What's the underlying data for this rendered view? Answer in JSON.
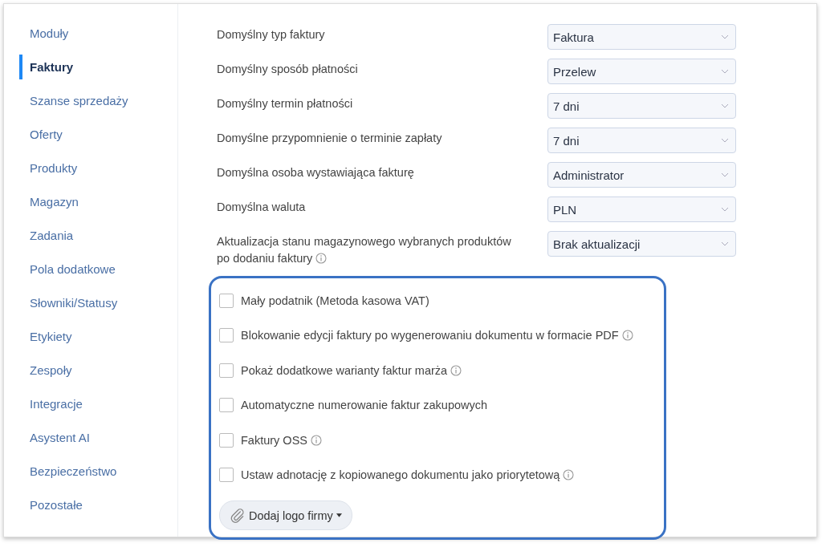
{
  "sidebar": {
    "items": [
      {
        "label": "Moduły",
        "selected": false
      },
      {
        "label": "Faktury",
        "selected": true
      },
      {
        "label": "Szanse sprzedaży",
        "selected": false
      },
      {
        "label": "Oferty",
        "selected": false
      },
      {
        "label": "Produkty",
        "selected": false
      },
      {
        "label": "Magazyn",
        "selected": false
      },
      {
        "label": "Zadania",
        "selected": false
      },
      {
        "label": "Pola dodatkowe",
        "selected": false
      },
      {
        "label": "Słowniki/Statusy",
        "selected": false
      },
      {
        "label": "Etykiety",
        "selected": false
      },
      {
        "label": "Zespoły",
        "selected": false
      },
      {
        "label": "Integracje",
        "selected": false
      },
      {
        "label": "Asystent AI",
        "selected": false
      },
      {
        "label": "Bezpieczeństwo",
        "selected": false
      },
      {
        "label": "Pozostałe",
        "selected": false
      }
    ]
  },
  "settings": [
    {
      "label": "Domyślny typ faktury",
      "value": "Faktura",
      "info": false
    },
    {
      "label": "Domyślny sposób płatności",
      "value": "Przelew",
      "info": false
    },
    {
      "label": "Domyślny termin płatności",
      "value": "7 dni",
      "info": false
    },
    {
      "label": "Domyślne przypomnienie o terminie zapłaty",
      "value": "7 dni",
      "info": false
    },
    {
      "label": "Domyślna osoba wystawiająca fakturę",
      "value": "Administrator",
      "info": false
    },
    {
      "label": "Domyślna waluta",
      "value": "PLN",
      "info": false
    },
    {
      "label": "Aktualizacja stanu magazynowego wybranych produktów po dodaniu faktury",
      "value": "Brak aktualizacji",
      "info": true
    }
  ],
  "options": [
    {
      "label": "Mały podatnik (Metoda kasowa VAT)",
      "checked": false,
      "info": false
    },
    {
      "label": "Blokowanie edycji faktury po wygenerowaniu dokumentu w formacie PDF",
      "checked": false,
      "info": true
    },
    {
      "label": "Pokaż dodatkowe warianty faktur marża",
      "checked": false,
      "info": true
    },
    {
      "label": "Automatyczne numerowanie faktur zakupowych",
      "checked": false,
      "info": false
    },
    {
      "label": "Faktury OSS",
      "checked": false,
      "info": true
    },
    {
      "label": "Ustaw adnotację z kopiowanego dokumentu jako priorytetową",
      "checked": false,
      "info": true
    }
  ],
  "logo_button": {
    "label": "Dodaj logo firmy"
  }
}
